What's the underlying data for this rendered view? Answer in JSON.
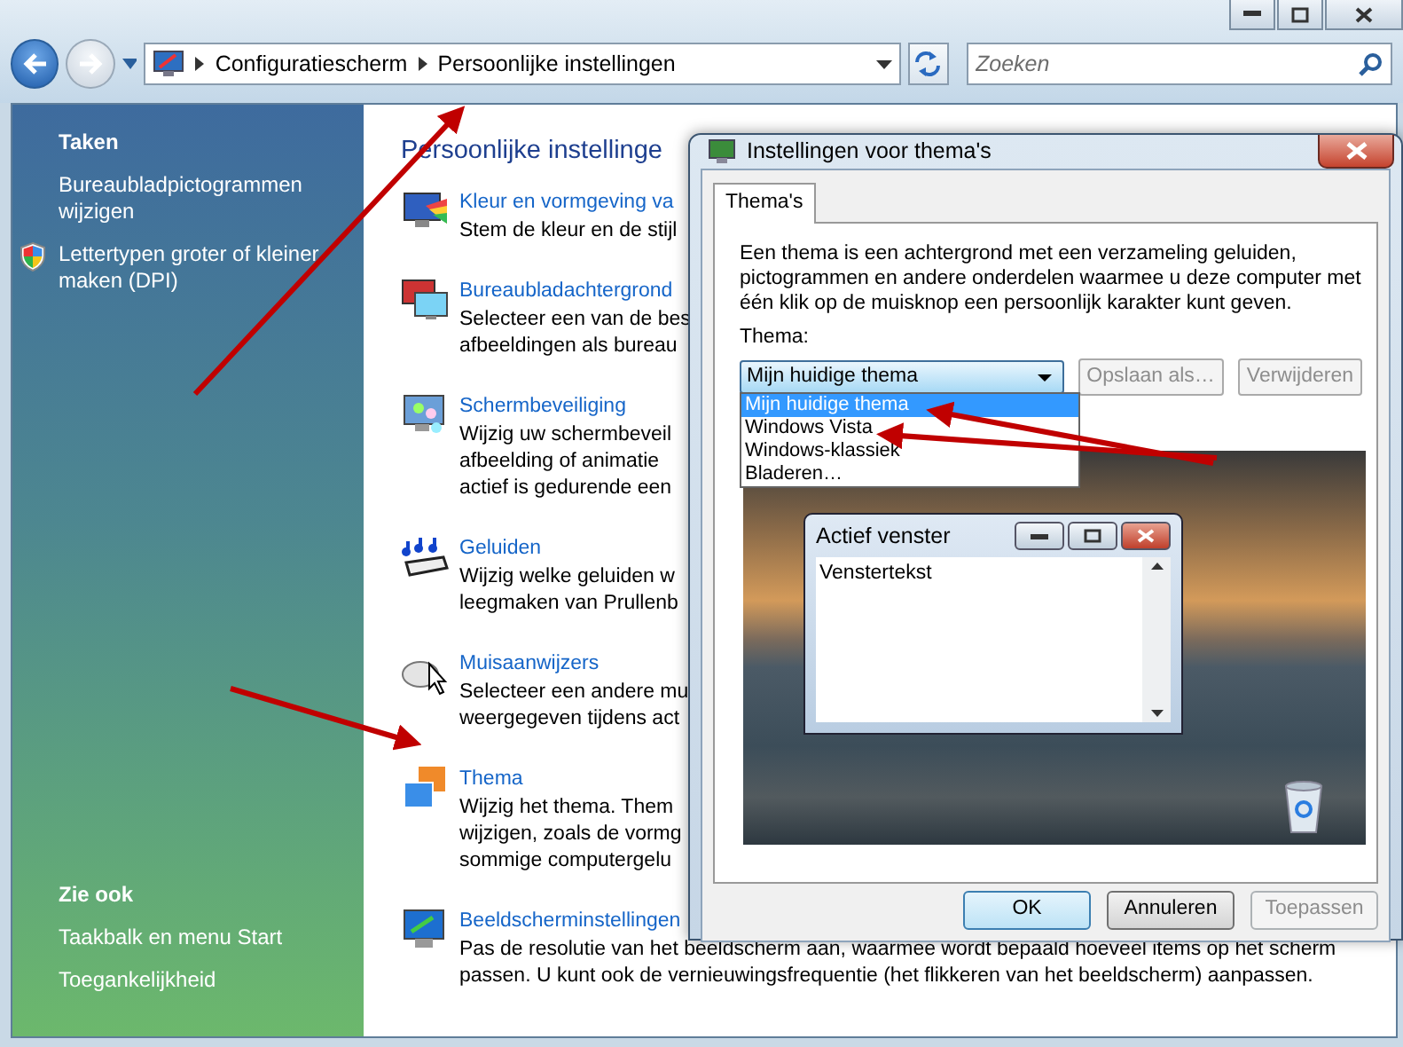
{
  "address_bar": {
    "crumbs": [
      "Configuratiescherm",
      "Persoonlijke instellingen"
    ]
  },
  "search": {
    "placeholder": "Zoeken"
  },
  "sidebar": {
    "tasks_title": "Taken",
    "tasks": [
      {
        "label": "Bureaubladpictogrammen wijzigen",
        "kind": "link"
      },
      {
        "label": "Lettertypen groter of kleiner maken (DPI)",
        "kind": "admin"
      }
    ],
    "see_also_title": "Zie ook",
    "see_also": [
      {
        "label": "Taakbalk en menu Start"
      },
      {
        "label": "Toegankelijkheid"
      }
    ]
  },
  "content": {
    "heading": "Persoonlijke instellinge",
    "items": [
      {
        "title": "Kleur en vormgeving va",
        "lines": [
          "Stem de kleur en de stijl"
        ]
      },
      {
        "title": "Bureaubladachtergrond",
        "lines": [
          "Selecteer een van de bes",
          "afbeeldingen als bureau"
        ]
      },
      {
        "title": "Schermbeveiliging",
        "lines": [
          "Wijzig uw schermbeveil",
          "afbeelding of animatie",
          "actief is gedurende een"
        ]
      },
      {
        "title": "Geluiden",
        "lines": [
          "Wijzig welke geluiden w",
          "leegmaken van Prullenb"
        ]
      },
      {
        "title": "Muisaanwijzers",
        "lines": [
          "Selecteer een andere mu",
          "weergegeven tijdens act"
        ]
      },
      {
        "title": "Thema",
        "lines": [
          "Wijzig het thema. Them",
          "wijzigen, zoals de vormg",
          "sommige computergelu"
        ]
      },
      {
        "title": "Beeldscherminstellingen",
        "lines": [
          "Pas de resolutie van het beeldscherm aan, waarmee wordt bepaald hoeveel items op het scherm",
          "passen. U kunt ook de vernieuwingsfrequentie (het flikkeren van het beeldscherm) aanpassen."
        ]
      }
    ]
  },
  "dialog": {
    "title": "Instellingen voor thema's",
    "tabs": [
      {
        "label": "Thema's",
        "selected": true
      }
    ],
    "description": "Een thema is een achtergrond met een verzameling geluiden, pictogrammen en andere onderdelen waarmee u deze computer met één klik op de muisknop een persoonlijk karakter kunt geven.",
    "theme_label": "Thema:",
    "theme_select": {
      "value": "Mijn huidige thema",
      "expanded": true,
      "options": [
        {
          "label": "Mijn huidige thema",
          "selected": true
        },
        {
          "label": "Windows Vista",
          "selected": false
        },
        {
          "label": "Windows-klassiek",
          "selected": false
        },
        {
          "label": "Bladeren…",
          "selected": false
        }
      ]
    },
    "side_buttons": [
      {
        "label": "Opslaan als…",
        "disabled": true
      },
      {
        "label": "Verwijderen",
        "disabled": true
      }
    ],
    "preview": {
      "window_title": "Actief venster",
      "window_text": "Venstertekst"
    },
    "buttons": [
      {
        "label": "OK",
        "default": true,
        "disabled": false
      },
      {
        "label": "Annuleren",
        "default": false,
        "disabled": false
      },
      {
        "label": "Toepassen",
        "default": false,
        "disabled": true
      }
    ]
  }
}
